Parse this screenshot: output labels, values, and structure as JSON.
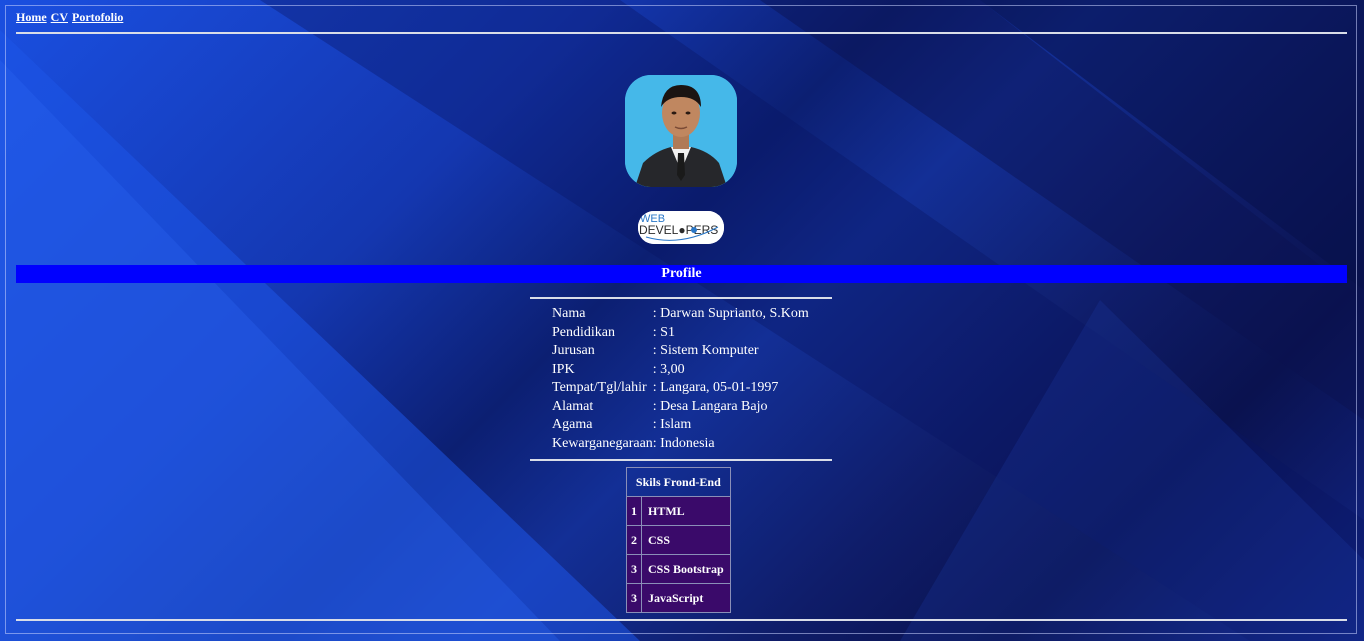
{
  "nav": {
    "home": "Home",
    "cv": "CV",
    "portfolio": "Portofolio"
  },
  "badge": {
    "line1": "WEB",
    "line2": "DEVEL●PERS"
  },
  "profile": {
    "title": "Profile",
    "rows": [
      {
        "label": "Nama",
        "value": ": Darwan Suprianto, S.Kom"
      },
      {
        "label": "Pendidikan",
        "value": ": S1"
      },
      {
        "label": "Jurusan",
        "value": ": Sistem Komputer"
      },
      {
        "label": "IPK",
        "value": ": 3,00"
      },
      {
        "label": "Tempat/Tgl/lahir",
        "value": ": Langara, 05-01-1997"
      },
      {
        "label": "Alamat",
        "value": ": Desa Langara Bajo"
      },
      {
        "label": "Agama",
        "value": ": Islam"
      },
      {
        "label": "Kewarganegaraan",
        "value": ": Indonesia"
      }
    ]
  },
  "skills": {
    "header": "Skils Frond-End",
    "items": [
      {
        "no": "1",
        "name": "HTML"
      },
      {
        "no": "2",
        "name": "CSS"
      },
      {
        "no": "3",
        "name": "CSS Bootstrap"
      },
      {
        "no": "3",
        "name": "JavaScript"
      }
    ]
  },
  "colors": {
    "profile_bar": "#0000ff",
    "skill_cell": "#3a0a6a"
  }
}
